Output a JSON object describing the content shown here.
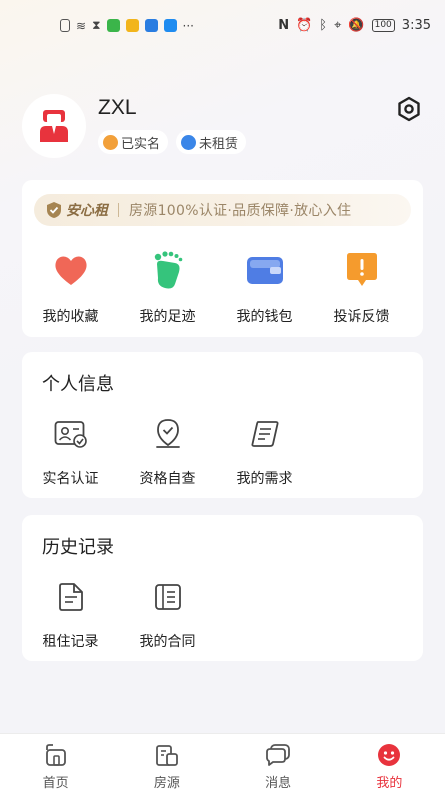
{
  "status_bar": {
    "time": "3:35",
    "battery": "100"
  },
  "profile": {
    "username": "ZXL",
    "badges": [
      "已实名",
      "未租赁"
    ]
  },
  "banner": {
    "brand": "安心租",
    "text": "房源100%认证·品质保障·放心入住"
  },
  "quick_actions": [
    {
      "label": "我的收藏",
      "icon": "heart-icon"
    },
    {
      "label": "我的足迹",
      "icon": "footprint-icon"
    },
    {
      "label": "我的钱包",
      "icon": "wallet-icon"
    },
    {
      "label": "投诉反馈",
      "icon": "feedback-icon"
    }
  ],
  "personal_info": {
    "title": "个人信息",
    "items": [
      {
        "label": "实名认证",
        "icon": "id-card-icon"
      },
      {
        "label": "资格自查",
        "icon": "qualification-icon"
      },
      {
        "label": "我的需求",
        "icon": "scroll-icon"
      }
    ]
  },
  "history": {
    "title": "历史记录",
    "items": [
      {
        "label": "租住记录",
        "icon": "document-icon"
      },
      {
        "label": "我的合同",
        "icon": "contract-icon"
      }
    ]
  },
  "tabbar": [
    {
      "label": "首页",
      "icon": "home-icon",
      "active": false
    },
    {
      "label": "房源",
      "icon": "building-icon",
      "active": false
    },
    {
      "label": "消息",
      "icon": "message-icon",
      "active": false
    },
    {
      "label": "我的",
      "icon": "profile-icon",
      "active": true
    }
  ],
  "colors": {
    "accent": "#e8333d",
    "brand_gold": "#8b6d43"
  }
}
